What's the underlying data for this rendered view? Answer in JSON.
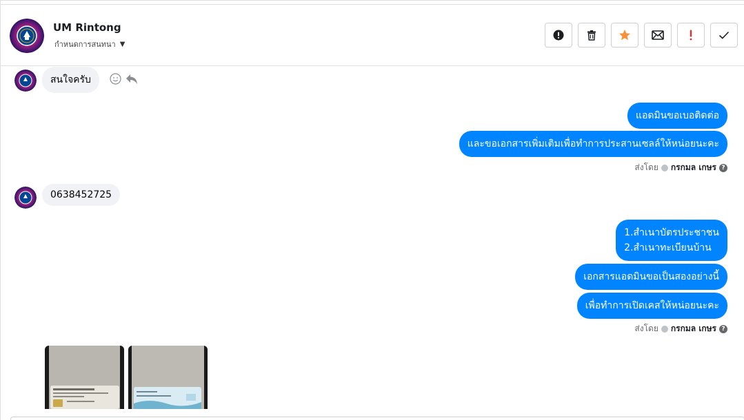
{
  "header": {
    "name": "UM Rintong",
    "subtitle": "กำหนดการสนทนา",
    "avatar_icon": "chelsea-crest-avatar",
    "toolbar": [
      {
        "name": "report-button",
        "icon": "exclamation-circle-icon",
        "color": "#1c1e21"
      },
      {
        "name": "delete-button",
        "icon": "trash-icon",
        "color": "#1c1e21"
      },
      {
        "name": "star-button",
        "icon": "star-icon",
        "color": "#f7923b"
      },
      {
        "name": "mark-unread-button",
        "icon": "envelope-icon",
        "color": "#1c1e21"
      },
      {
        "name": "important-button",
        "icon": "exclamation-icon",
        "color": "#e02d2d"
      },
      {
        "name": "done-button",
        "icon": "checkmark-icon",
        "color": "#1c1e21"
      }
    ]
  },
  "messages": {
    "in1": "สนใจครับ",
    "out1": "แอดมินขอเบอติดต่อ",
    "out2": "และขอเอกสารเพิ่มเติมเพื่อทำการประสานเซลล์ให้หน่อยนะคะ",
    "in2": "0638452725",
    "out3_line1": "1.สำเนาบัตรประชาชน",
    "out3_line2": "2.สำเนาทะเบียนบ้าน",
    "out4": "เอกสารแอดมินขอเป็นสองอย่างนี้",
    "out5": "เพื่อทำการเปิดเคสให้หน่อยนะคะ"
  },
  "sent_by": {
    "prefix": "ส่งโดย",
    "sender": "กรกมล เกษร",
    "help": "?"
  },
  "colors": {
    "outgoing_bubble": "#0084ff",
    "incoming_bubble": "#f0f2f5"
  }
}
